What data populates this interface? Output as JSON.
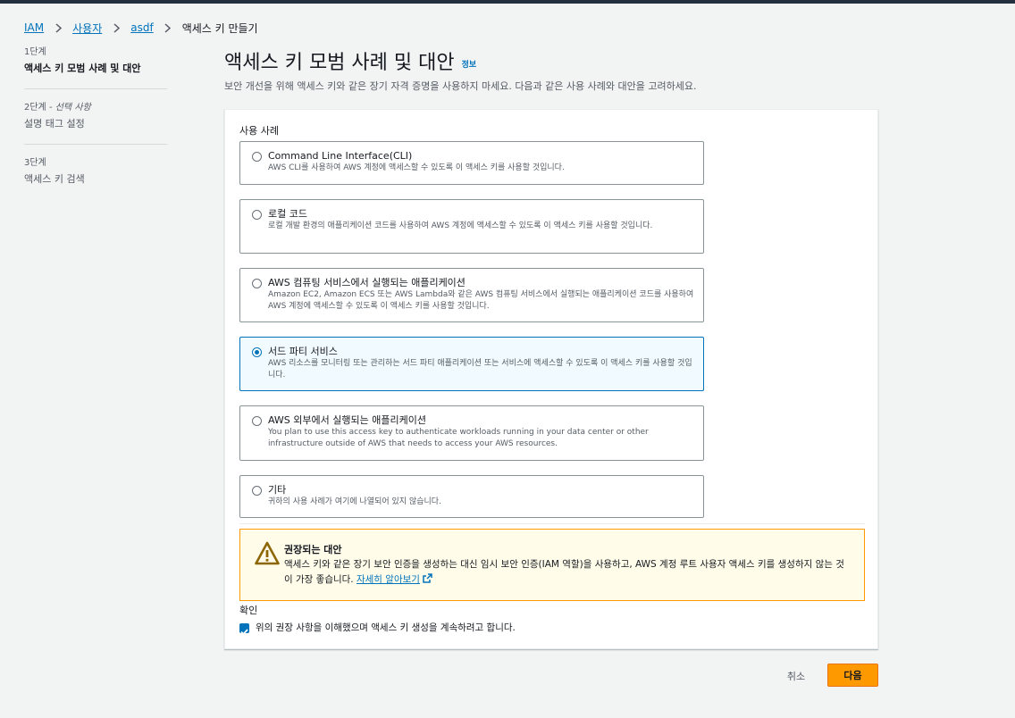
{
  "breadcrumb": {
    "items": [
      "IAM",
      "사용자",
      "asdf"
    ],
    "current": "액세스 키 만들기"
  },
  "steps": [
    {
      "label": "1단계",
      "optional": "",
      "name": "액세스 키 모범 사례 및 대안"
    },
    {
      "label": "2단계 - ",
      "optional": "선택 사항",
      "name": "설명 태그 설정"
    },
    {
      "label": "3단계",
      "optional": "",
      "name": "액세스 키 검색"
    }
  ],
  "page": {
    "title": "액세스 키 모범 사례 및 대안",
    "info": "정보",
    "subtitle": "보안 개선을 위해 액세스 키와 같은 장기 자격 증명을 사용하지 마세요. 다음과 같은 사용 사례와 대안을 고려하세요."
  },
  "usecase": {
    "label": "사용 사례",
    "selected_index": 3,
    "options": [
      {
        "title": "Command Line Interface(CLI)",
        "desc": "AWS CLI를 사용하여 AWS 계정에 액세스할 수 있도록 이 액세스 키를 사용할 것입니다."
      },
      {
        "title": "로컬 코드",
        "desc": "로컬 개발 환경의 애플리케이션 코드를 사용하여 AWS 계정에 액세스할 수 있도록 이 액세스 키를 사용할 것입니다."
      },
      {
        "title": "AWS 컴퓨팅 서비스에서 실행되는 애플리케이션",
        "desc": "Amazon EC2, Amazon ECS 또는 AWS Lambda와 같은 AWS 컴퓨팅 서비스에서 실행되는 애플리케이션 코드를 사용하여 AWS 계정에 액세스할 수 있도록 이 액세스 키를 사용할 것입니다."
      },
      {
        "title": "서드 파티 서비스",
        "desc": "AWS 리소스를 모니터링 또는 관리하는 서드 파티 애플리케이션 또는 서비스에 액세스할 수 있도록 이 액세스 키를 사용할 것입니다."
      },
      {
        "title": "AWS 외부에서 실행되는 애플리케이션",
        "desc": "You plan to use this access key to authenticate workloads running in your data center or other infrastructure outside of AWS that needs to access your AWS resources."
      },
      {
        "title": "기타",
        "desc": "귀하의 사용 사례가 여기에 나열되어 있지 않습니다."
      }
    ]
  },
  "alert": {
    "title": "권장되는 대안",
    "body": "액세스 키와 같은 장기 보안 인증을 생성하는 대신 임시 보안 인증(IAM 역할)을 사용하고, AWS 계정 루트 사용자 액세스 키를 생성하지 않는 것이 가장 좋습니다.",
    "link": "자세히 알아보기"
  },
  "confirm": {
    "label": "확인",
    "checked": true,
    "text": "위의 권장 사항을 이해했으며 액세스 키 생성을 계속하려고 합니다."
  },
  "buttons": {
    "cancel": "취소",
    "next": "다음"
  },
  "colors": {
    "link": "#0073bb",
    "primary": "#ff9900",
    "warning_border": "#ff9900",
    "warning_bg": "#fffce9"
  }
}
